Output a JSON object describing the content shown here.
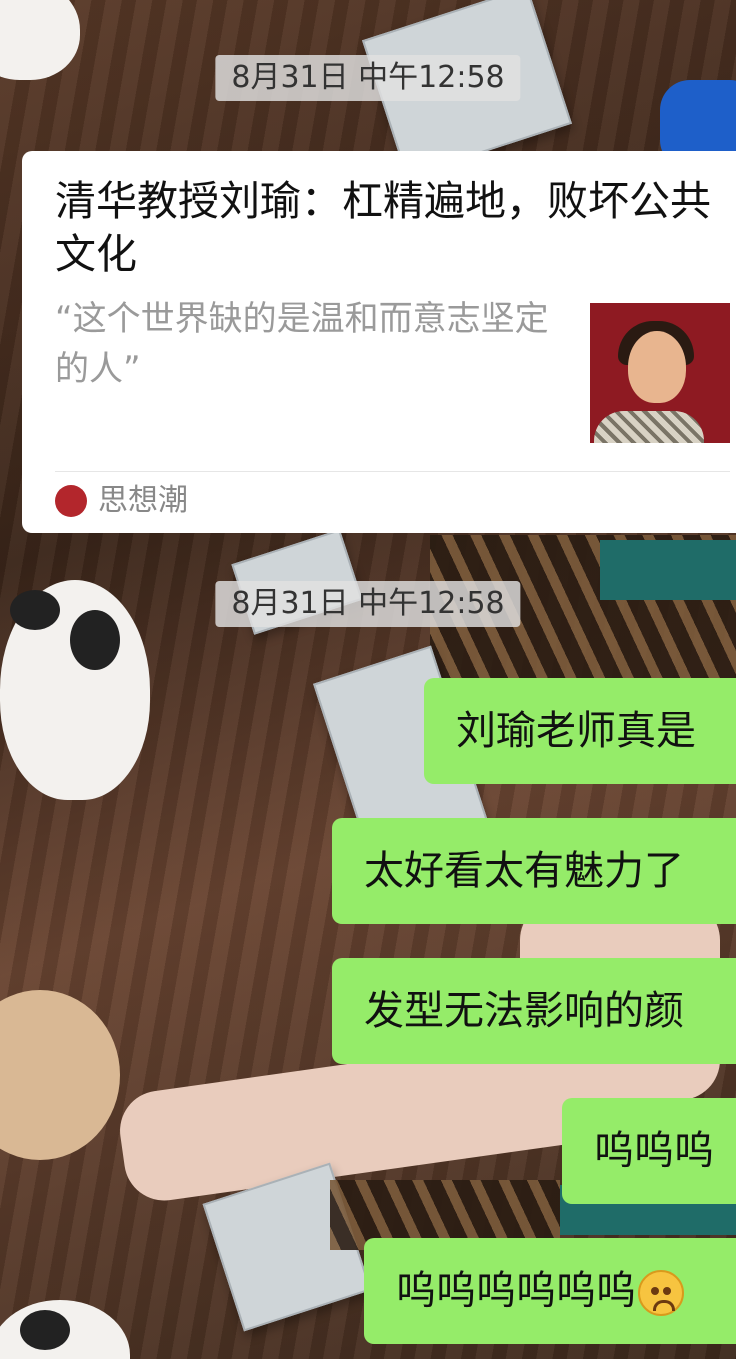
{
  "timestamps": [
    "8月31日 中午12:58",
    "8月31日 中午12:58"
  ],
  "article_card": {
    "title": "清华教授刘瑜：杠精遍地，败坏公共文化",
    "description": "“这个世界缺的是温和而意志坚定的人”",
    "source": "思想潮",
    "source_icon": "publisher-logo-icon",
    "thumbnail": "portrait-image"
  },
  "messages": [
    {
      "text": "刘瑜老师真是"
    },
    {
      "text": "太好看太有魅力了"
    },
    {
      "text": "发型无法影响的颜"
    },
    {
      "text": "呜呜呜"
    },
    {
      "text": "呜呜呜呜呜呜",
      "emoji": "sad-face-icon"
    }
  ],
  "colors": {
    "bubble": "#95ec69",
    "card": "#ffffff",
    "timestamp_bg": "#e1e1e1",
    "source_logo": "#b3262c"
  }
}
